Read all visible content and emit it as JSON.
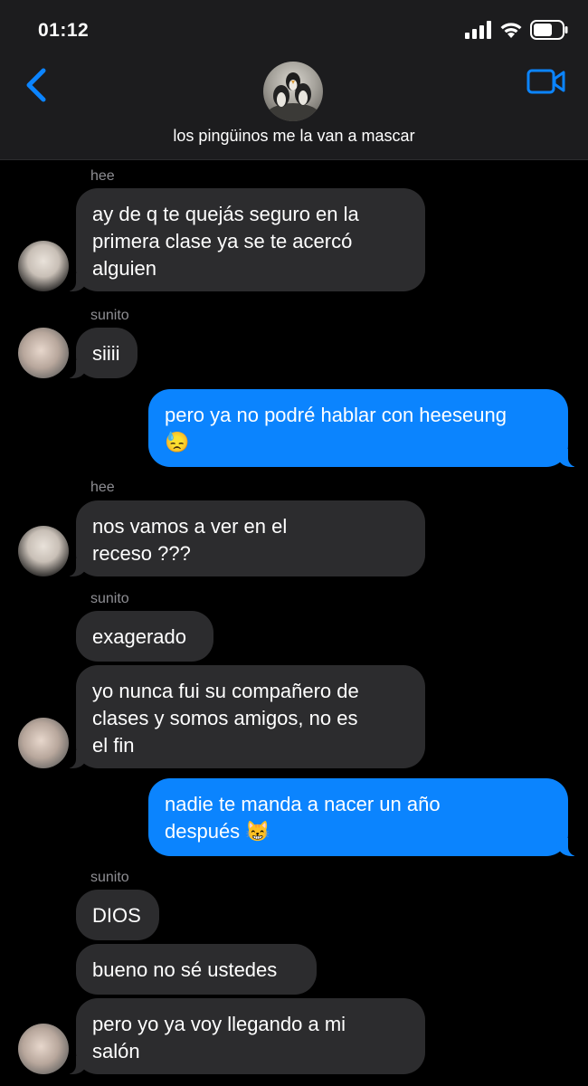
{
  "status": {
    "time": "01:12"
  },
  "header": {
    "title": "los pingüinos me la van a mascar"
  },
  "messages": [
    {
      "sender": "hee",
      "text": "ay de q te quejás seguro en la\nprimera clase ya se te acercó\nalguien"
    },
    {
      "sender": "sunito",
      "text": "siiii"
    },
    {
      "text": "pero ya no podré hablar con heeseung\n😓"
    },
    {
      "sender": "hee",
      "text": "nos vamos a ver en el\nreceso ???"
    },
    {
      "sender": "sunito",
      "text": "exagerado"
    },
    {
      "text": "yo nunca fui su compañero de\nclases y somos amigos, no es\nel fin"
    },
    {
      "text": "nadie te manda a nacer un año\ndespués 😸"
    },
    {
      "sender": "sunito",
      "text": "DIOS"
    },
    {
      "text": "bueno no sé ustedes"
    },
    {
      "text": "pero yo ya voy llegando a mi\nsalón"
    }
  ],
  "icons": {
    "back": "chevron-left-icon",
    "video": "video-camera-icon",
    "signal": "cellular-signal-icon",
    "wifi": "wifi-icon",
    "battery": "battery-icon"
  },
  "colors": {
    "accent": "#0b84fe",
    "incoming": "#2c2c2e",
    "header": "#1c1c1e"
  }
}
